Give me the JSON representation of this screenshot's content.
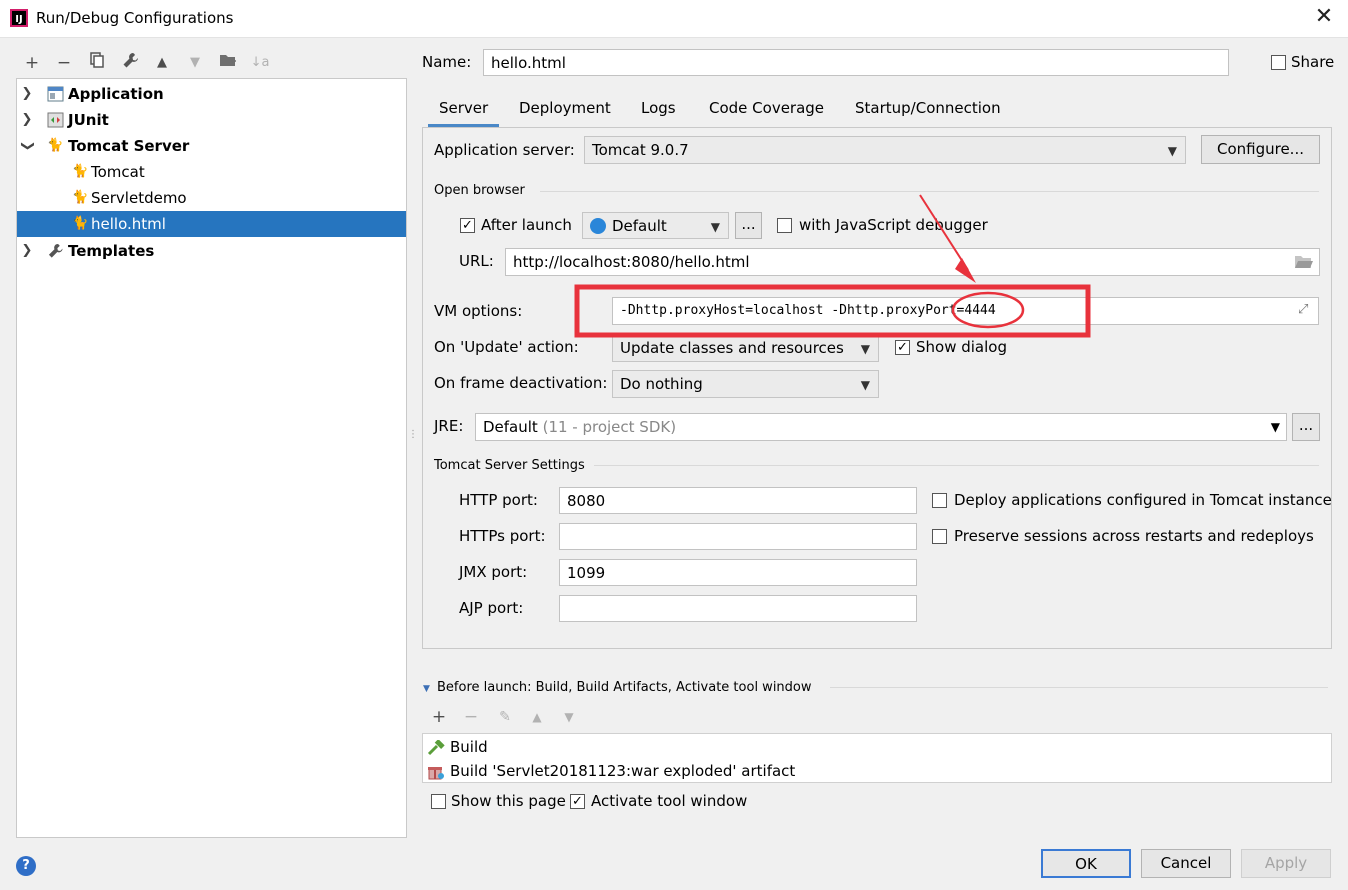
{
  "window": {
    "title": "Run/Debug Configurations",
    "app_icon": "IJ"
  },
  "toolbar": {
    "add": "+",
    "remove": "−",
    "copy": "⧉",
    "edit": "🔧",
    "up": "▲",
    "down": "▼",
    "folder": "📁",
    "sort": "↓a"
  },
  "tree": [
    {
      "label": "Application",
      "bold": true
    },
    {
      "label": "JUnit",
      "bold": true
    },
    {
      "label": "Tomcat Server",
      "bold": true
    },
    {
      "label": "Tomcat",
      "bold": false
    },
    {
      "label": "Servletdemo",
      "bold": false
    },
    {
      "label": "hello.html",
      "bold": false,
      "selected": true
    },
    {
      "label": "Templates",
      "bold": true
    }
  ],
  "name": {
    "label": "Name:",
    "value": "hello.html"
  },
  "share": {
    "label": "Share",
    "checked": false
  },
  "tabs": [
    "Server",
    "Deployment",
    "Logs",
    "Code Coverage",
    "Startup/Connection"
  ],
  "server": {
    "app_server_label": "Application server:",
    "app_server_value": "Tomcat 9.0.7",
    "configure_label": "Configure...",
    "open_browser_label": "Open browser",
    "after_launch_label": "After launch",
    "after_launch_checked": true,
    "browser_value": "Default",
    "browse_btn": "...",
    "js_debugger_label": "with JavaScript debugger",
    "js_debugger_checked": false,
    "url_label": "URL:",
    "url_value": "http://localhost:8080/hello.html",
    "vm_label": "VM options:",
    "vm_value": "-Dhttp.proxyHost=localhost -Dhttp.proxyPort=4444",
    "update_label": "On 'Update' action:",
    "update_value": "Update classes and resources",
    "show_dialog_label": "Show dialog",
    "show_dialog_checked": true,
    "frame_label": "On frame deactivation:",
    "frame_value": "Do nothing",
    "jre_label": "JRE:",
    "jre_value": "Default",
    "jre_hint": "(11 - project SDK)",
    "jre_btn": "...",
    "tomcat_settings_label": "Tomcat Server Settings",
    "http_label": "HTTP port:",
    "http_value": "8080",
    "https_label": "HTTPs port:",
    "https_value": "",
    "jmx_label": "JMX port:",
    "jmx_value": "1099",
    "ajp_label": "AJP port:",
    "ajp_value": "",
    "deploy_label": "Deploy applications configured in Tomcat instance",
    "deploy_checked": false,
    "preserve_label": "Preserve sessions across restarts and redeploys",
    "preserve_checked": false
  },
  "before_launch": {
    "label": "Before launch: Build, Build Artifacts, Activate tool window",
    "items": [
      "Build",
      "Build 'Servlet20181123:war exploded' artifact"
    ],
    "show_page_label": "Show this page",
    "show_page_checked": false,
    "activate_label": "Activate tool window",
    "activate_checked": true
  },
  "buttons": {
    "ok": "OK",
    "cancel": "Cancel",
    "apply": "Apply"
  },
  "help": "?",
  "colors": {
    "selection": "#2675bf",
    "annotation": "#e8323c",
    "tab_underline": "#4a88c7"
  }
}
